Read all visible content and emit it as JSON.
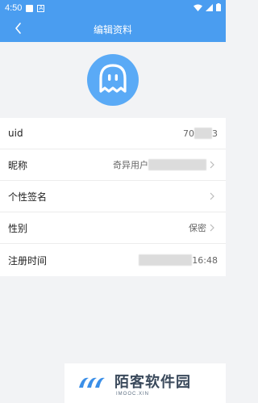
{
  "status_bar": {
    "time": "4:50",
    "a_badge": "A"
  },
  "header": {
    "title": "编辑资料"
  },
  "profile": {
    "rows": [
      {
        "label": "uid",
        "value_prefix": "70",
        "value_suffix": "3"
      },
      {
        "label": "昵称",
        "value_prefix": "奇异用户",
        "value_suffix": ""
      },
      {
        "label": "个性签名",
        "value_prefix": "",
        "value_suffix": ""
      },
      {
        "label": "性别",
        "value_prefix": "保密",
        "value_suffix": ""
      },
      {
        "label": "注册时间",
        "value_prefix": "",
        "value_suffix": "16:48"
      }
    ]
  },
  "watermark": {
    "text": "陌客软件园",
    "subtext": "IMOOC.XIN"
  },
  "colors": {
    "primary": "#4a9df0",
    "avatar_bg": "#5aaaf6",
    "page_bg": "#f2f3f5"
  }
}
